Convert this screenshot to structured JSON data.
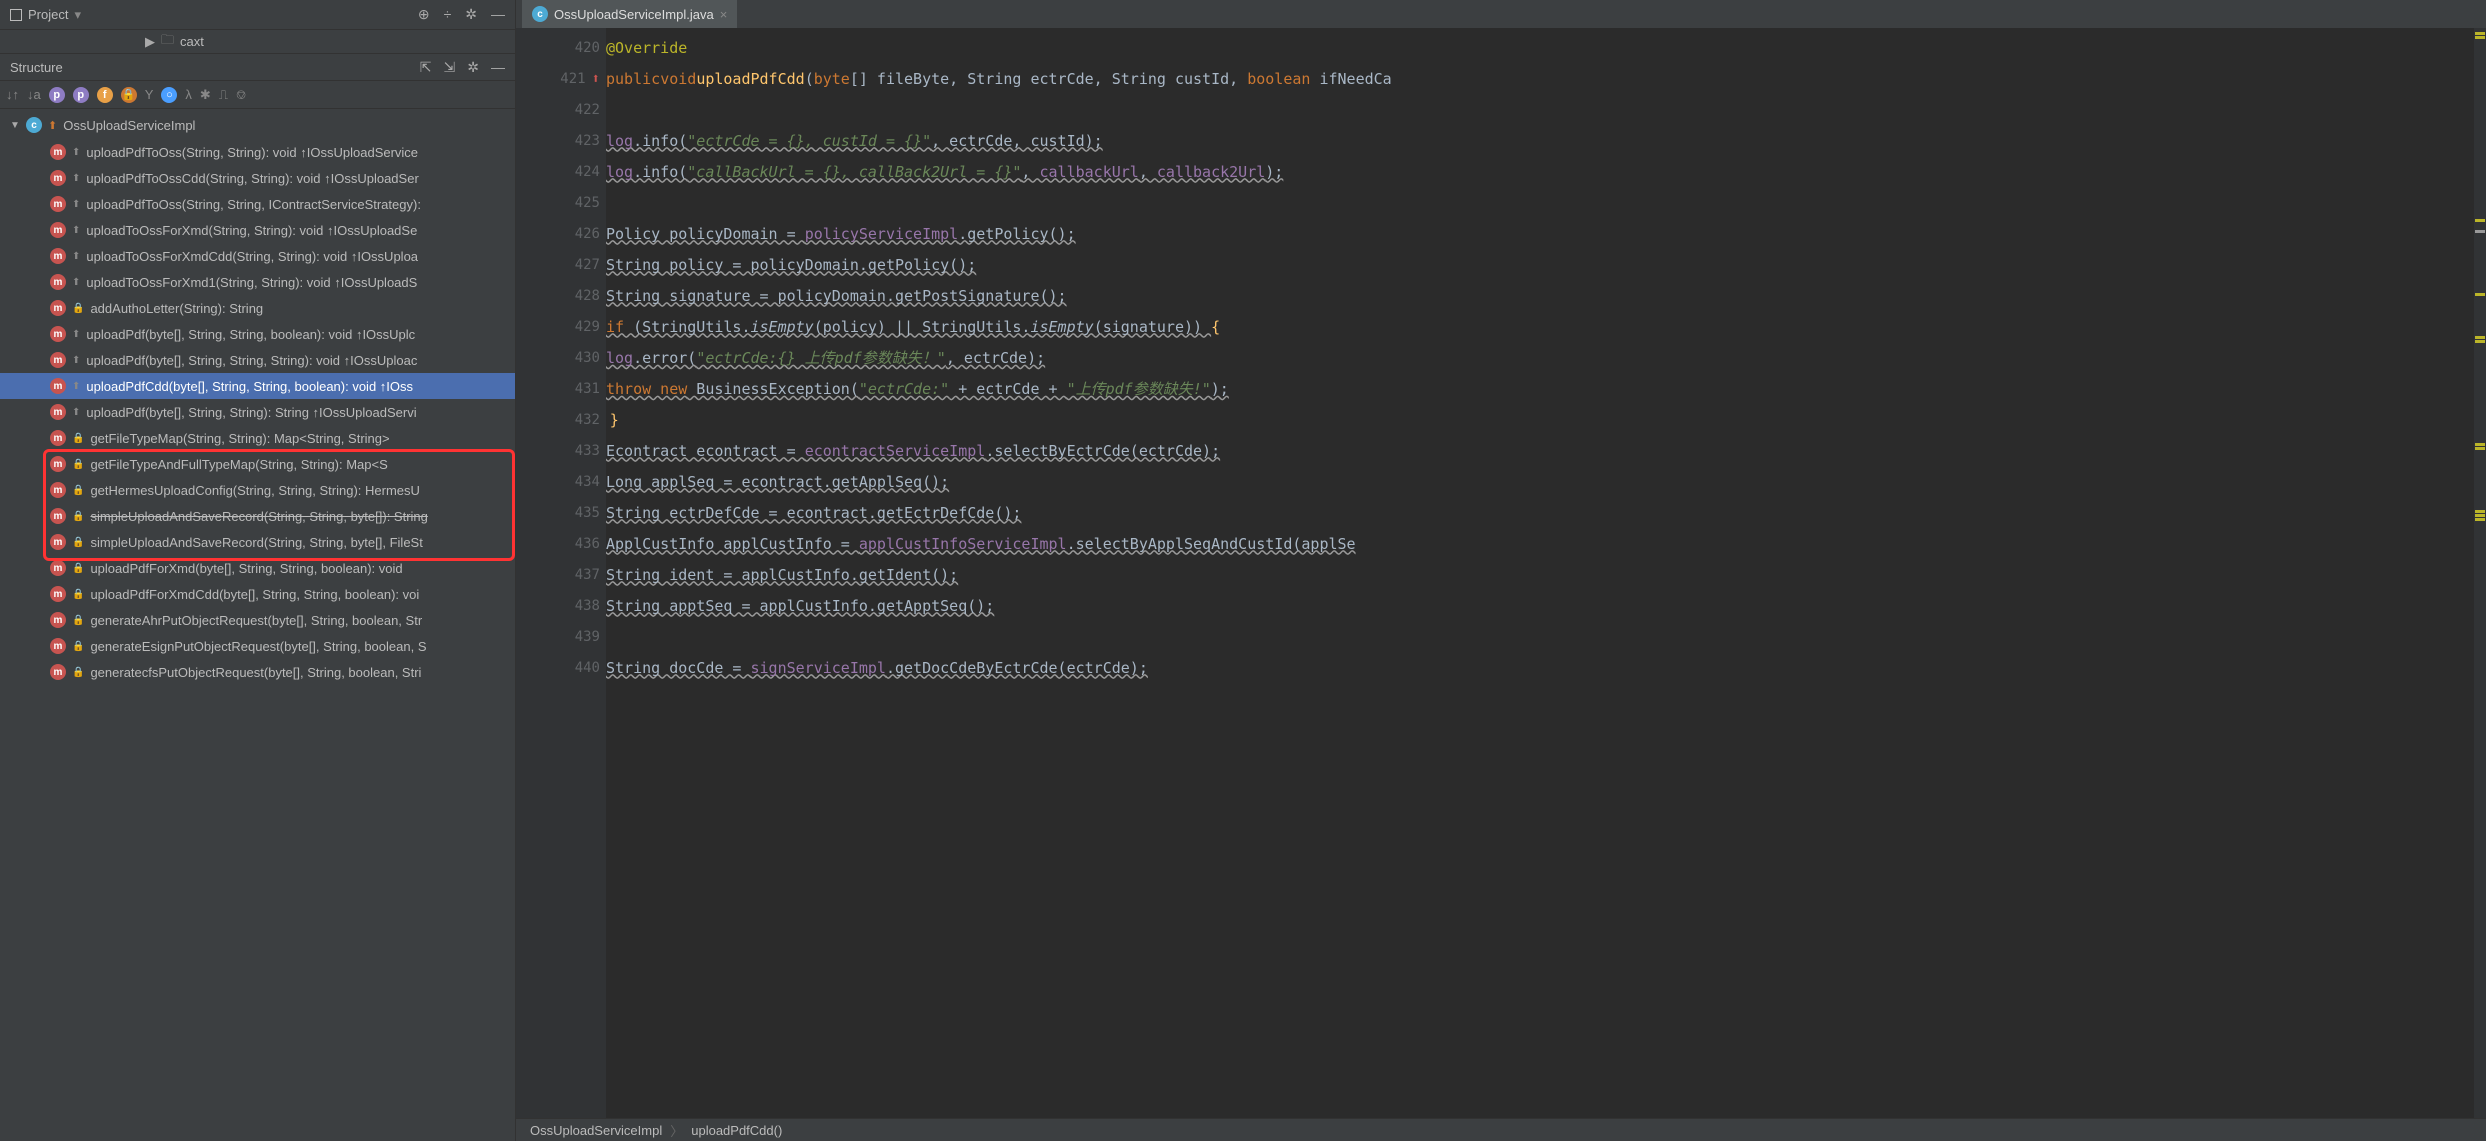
{
  "project_header": {
    "label": "Project",
    "tree_folder": "caxt"
  },
  "structure_header": {
    "label": "Structure"
  },
  "class_name": "OssUploadServiceImpl",
  "methods": [
    {
      "name": "uploadPdfToOss(String, String): void ↑IOssUploadService",
      "hasOverride": true
    },
    {
      "name": "uploadPdfToOssCdd(String, String): void ↑IOssUploadSer",
      "hasOverride": true
    },
    {
      "name": "uploadPdfToOss(String, String, IContractServiceStrategy):",
      "hasOverride": true
    },
    {
      "name": "uploadToOssForXmd(String, String): void ↑IOssUploadSe",
      "hasOverride": true
    },
    {
      "name": "uploadToOssForXmdCdd(String, String): void ↑IOssUploa",
      "hasOverride": true
    },
    {
      "name": "uploadToOssForXmd1(String, String): void ↑IOssUploadS",
      "hasOverride": true
    },
    {
      "name": "addAuthoLetter(String): String",
      "locked": true
    },
    {
      "name": "uploadPdf(byte[], String, String, boolean): void ↑IOssUplc",
      "hasOverride": true,
      "boxed": true
    },
    {
      "name": "uploadPdf(byte[], String, String, String): void ↑IOssUploac",
      "hasOverride": true,
      "boxed": true
    },
    {
      "name": "uploadPdfCdd(byte[], String, String, boolean): void ↑IOss",
      "hasOverride": true,
      "selected": true,
      "boxed": true
    },
    {
      "name": "uploadPdf(byte[], String, String): String ↑IOssUploadServi",
      "hasOverride": true,
      "boxed": true
    },
    {
      "name": "getFileTypeMap(String, String): Map<String, String>",
      "locked": true
    },
    {
      "name": "getFileTypeAndFullTypeMap(String, String): Map<S",
      "locked": true
    },
    {
      "name": "getHermesUploadConfig(String, String, String): HermesU",
      "locked": true
    },
    {
      "name": "simpleUploadAndSaveRecord(String, String, byte[]): String",
      "locked": true,
      "strikethrough": true
    },
    {
      "name": "simpleUploadAndSaveRecord(String, String, byte[], FileSt",
      "locked": true
    },
    {
      "name": "uploadPdfForXmd(byte[], String, String, boolean): void",
      "locked": true
    },
    {
      "name": "uploadPdfForXmdCdd(byte[], String, String, boolean): voi",
      "locked": true
    },
    {
      "name": "generateAhrPutObjectRequest(byte[], String, boolean, Str",
      "locked": true
    },
    {
      "name": "generateEsignPutObjectRequest(byte[], String, boolean, S",
      "locked": true
    },
    {
      "name": "generatecfsPutObjectRequest(byte[], String, boolean, Stri",
      "locked": true
    }
  ],
  "tab": {
    "filename": "OssUploadServiceImpl.java"
  },
  "line_numbers": [
    420,
    421,
    422,
    423,
    424,
    425,
    426,
    427,
    428,
    429,
    430,
    431,
    432,
    433,
    434,
    435,
    436,
    437,
    438,
    439,
    440
  ],
  "breadcrumb": {
    "class": "OssUploadServiceImpl",
    "method": "uploadPdfCdd()"
  },
  "code": {
    "l420": "@Override",
    "l421_public": "public",
    "l421_void": "void",
    "l421_fn": "uploadPdfCdd",
    "l421_sig": "(byte[] fileByte, String ectrCde, String custId, boolean ifNeedCa",
    "l423_log": "log",
    "l423_info": ".info(",
    "l423_str": "\"ectrCde = {}, custId = {}\"",
    "l423_rest": ", ectrCde, custId);",
    "l424_log": "log",
    "l424_info": ".info(",
    "l424_str": "\"callBackUrl = {}, callBack2Url = {}\"",
    "l424_rest": ", callbackUrl, callback2Url);",
    "l426": "Policy policyDomain = ",
    "l426_field": "policyServiceImpl",
    "l426_rest": ".getPolicy();",
    "l427": "String policy = policyDomain.getPolicy();",
    "l428": "String signature = policyDomain.getPostSignature();",
    "l429_if": "if",
    "l429_a": " (StringUtils.",
    "l429_ie1": "isEmpty",
    "l429_b": "(policy) || StringUtils.",
    "l429_ie2": "isEmpty",
    "l429_c": "(signature)) ",
    "l429_brace": "{",
    "l430_log": "log",
    "l430_err": ".error(",
    "l430_str": "\"ectrCde:{} 上传pdf参数缺失！\"",
    "l430_rest": ", ectrCde);",
    "l431_throw": "throw new",
    "l431_ex": " BusinessException(",
    "l431_s1": "\"ectrCde:\"",
    "l431_plus": " + ectrCde + ",
    "l431_s2": "\"上传pdf参数缺失!\"",
    "l431_end": ");",
    "l432": "}",
    "l433": "Econtract econtract = ",
    "l433_f": "econtractServiceImpl",
    "l433_r": ".selectByEctrCde(ectrCde);",
    "l434": "Long applSeq = econtract.getApplSeq();",
    "l435": "String ectrDefCde = econtract.getEctrDefCde();",
    "l436": "ApplCustInfo applCustInfo = ",
    "l436_f": "applCustInfoServiceImpl",
    "l436_r": ".selectByApplSeqAndCustId(applSe",
    "l437": "String ident = applCustInfo.getIdent();",
    "l438": "String apptSeq = applCustInfo.getApptSeq();",
    "l440": "String docCde = ",
    "l440_f": "signServiceImpl",
    "l440_r": ".getDocCdeByEctrCde(ectrCde);"
  }
}
